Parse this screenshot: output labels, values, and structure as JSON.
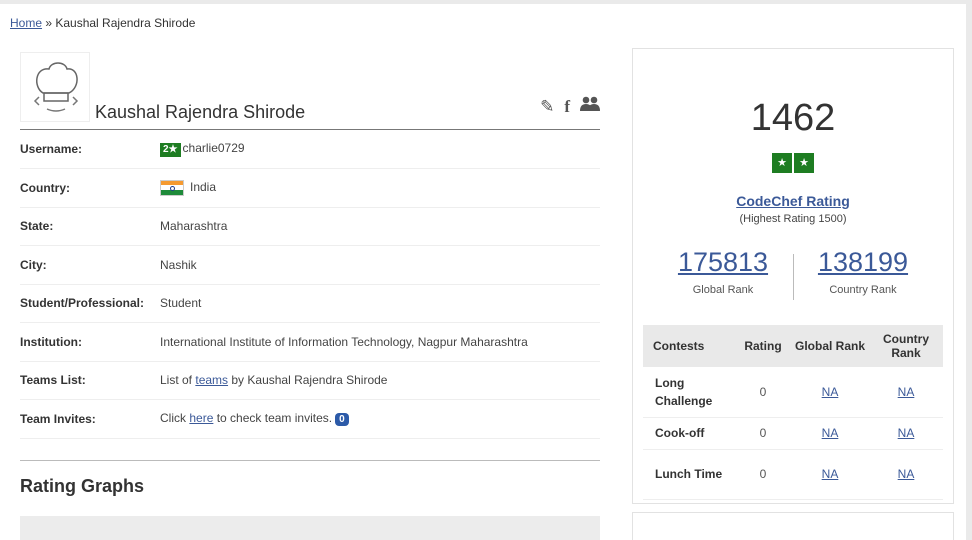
{
  "breadcrumb": {
    "home": "Home",
    "sep": " » ",
    "current": "Kaushal Rajendra Shirode"
  },
  "profile": {
    "name": "Kaushal Rajendra Shirode",
    "icons": [
      "pencil-icon",
      "facebook-icon",
      "users-icon"
    ],
    "fields": [
      {
        "key": "Username:",
        "badge": "2★",
        "value": "charlie0729"
      },
      {
        "key": "Country:",
        "value": "India"
      },
      {
        "key": "State:",
        "value": "Maharashtra"
      },
      {
        "key": "City:",
        "value": "Nashik"
      },
      {
        "key": "Student/Professional:",
        "value": "Student"
      },
      {
        "key": "Institution:",
        "value": "International Institute of Information Technology, Nagpur Maharashtra"
      },
      {
        "key": "Teams List:",
        "pre": "List of ",
        "link": "teams",
        "post": " by Kaushal Rajendra Shirode"
      },
      {
        "key": "Team Invites:",
        "pre": "Click ",
        "link": "here",
        "post": " to check team invites.",
        "count": "0"
      }
    ]
  },
  "rating_graphs": {
    "title": "Rating Graphs"
  },
  "rating": {
    "value": "1462",
    "stars": [
      "★",
      "★"
    ],
    "label": "CodeChef Rating",
    "highest": "(Highest Rating 1500)",
    "global_rank": "175813",
    "global_rank_label": "Global Rank",
    "country_rank": "138199",
    "country_rank_label": "Country Rank"
  },
  "contests": {
    "headers": [
      "Contests",
      "Rating",
      "Global Rank",
      "Country Rank"
    ],
    "rows": [
      {
        "name": "Long Challenge",
        "rating": "0",
        "global": "NA",
        "country": "NA"
      },
      {
        "name": "Cook-off",
        "rating": "0",
        "global": "NA",
        "country": "NA"
      },
      {
        "name": "Lunch Time",
        "rating": "0",
        "global": "NA",
        "country": "NA"
      }
    ]
  },
  "colors": {
    "accent": "#3b5998",
    "star_green": "#1e7d22",
    "invite_badge": "#2c5aa8"
  }
}
